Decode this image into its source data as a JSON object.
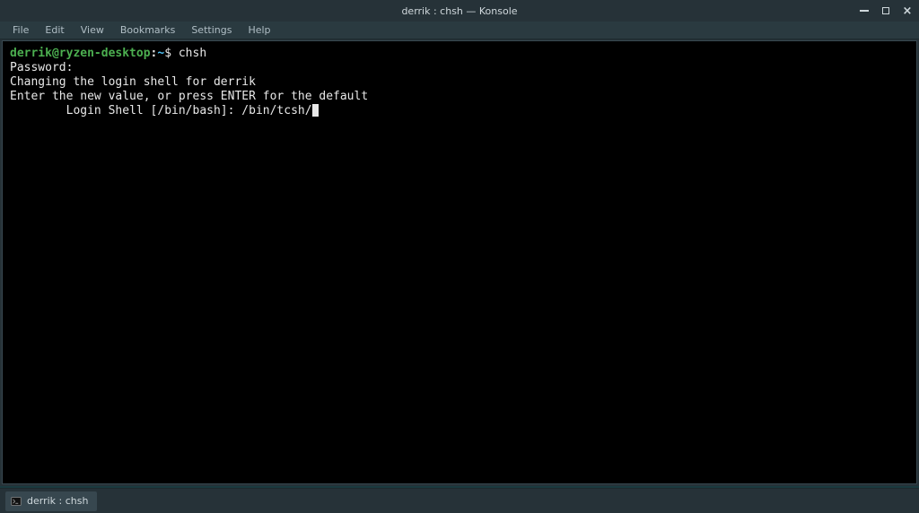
{
  "window": {
    "title": "derrik : chsh — Konsole"
  },
  "menubar": {
    "items": [
      "File",
      "Edit",
      "View",
      "Bookmarks",
      "Settings",
      "Help"
    ]
  },
  "terminal": {
    "prompt": {
      "userhost": "derrik@ryzen-desktop",
      "colon": ":",
      "path": "~",
      "dollar": "$",
      "command": "chsh"
    },
    "lines": [
      "Password:",
      "Changing the login shell for derrik",
      "Enter the new value, or press ENTER for the default"
    ],
    "input_line": {
      "indent": "        ",
      "label": "Login Shell [/bin/bash]: ",
      "value": "/bin/tcsh/"
    }
  },
  "taskbar": {
    "task_label": "derrik : chsh"
  }
}
